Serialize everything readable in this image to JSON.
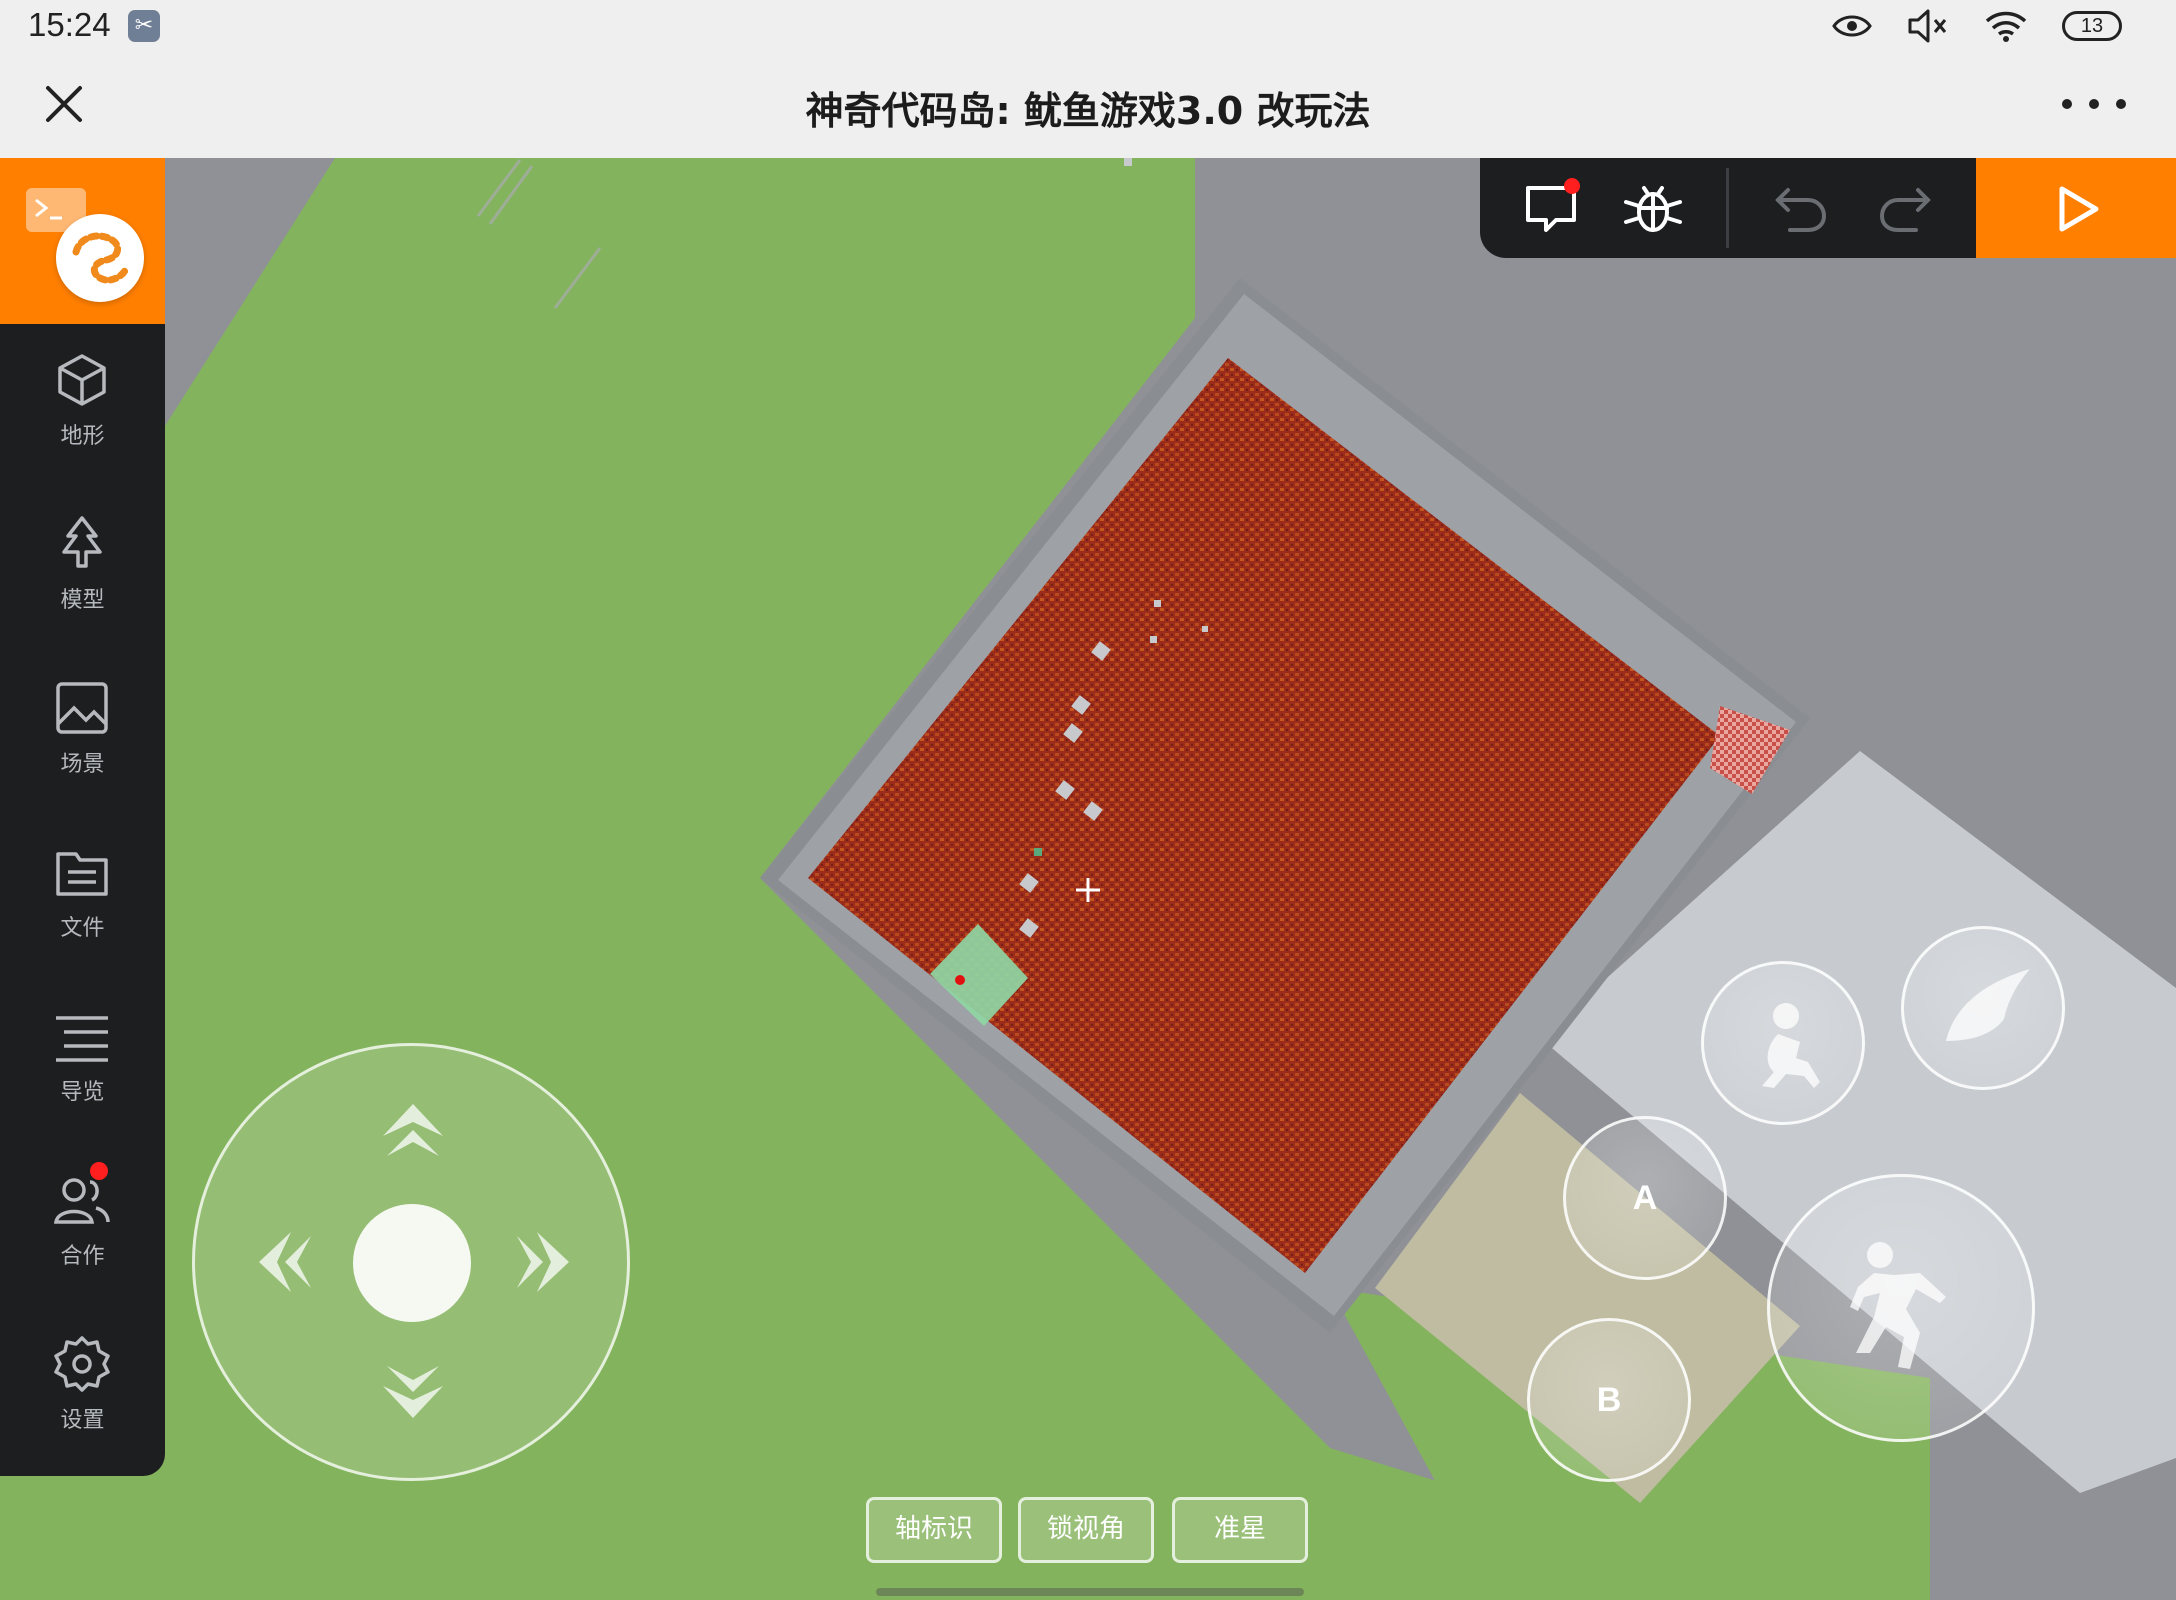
{
  "status_bar": {
    "time": "15:24",
    "app_icon": "scissors-icon",
    "icons": [
      "eye-icon",
      "speaker-muted-icon",
      "wifi-icon",
      "battery-icon"
    ],
    "battery_level": "13"
  },
  "title_bar": {
    "close_icon": "close-icon",
    "title": "神奇代码岛: 鱿鱼游戏3.0 改玩法",
    "more_icon": "more-dots-icon"
  },
  "sidebar": {
    "items": [
      {
        "label": "地形",
        "icon": "cube-icon"
      },
      {
        "label": "模型",
        "icon": "tree-icon"
      },
      {
        "label": "场景",
        "icon": "image-icon"
      },
      {
        "label": "文件",
        "icon": "folder-icon"
      },
      {
        "label": "导览",
        "icon": "list-icon"
      },
      {
        "label": "合作",
        "icon": "people-icon",
        "badge": true
      },
      {
        "label": "设置",
        "icon": "gear-icon"
      }
    ]
  },
  "toolbar": {
    "buttons": [
      "comment-icon",
      "bug-icon",
      "undo-icon",
      "redo-icon"
    ],
    "run_icon": "play-icon"
  },
  "controls": {
    "joystick_icons": [
      "arrow-up-icon",
      "arrow-left-icon",
      "arrow-right-icon",
      "arrow-down-icon"
    ],
    "action_a": "A",
    "action_b": "B",
    "crouch_icon": "crouch-icon",
    "fly_icon": "wing-icon",
    "jump_icon": "jump-icon"
  },
  "bottom_toggles": {
    "axis": "轴标识",
    "lock_view": "锁视角",
    "crosshair": "准星"
  },
  "colors": {
    "accent": "#ff7f00",
    "sidebar_bg": "#1c1e20",
    "grass": "#84b35d",
    "ground": "#8f9196",
    "carpet": "#9a2c1c"
  }
}
